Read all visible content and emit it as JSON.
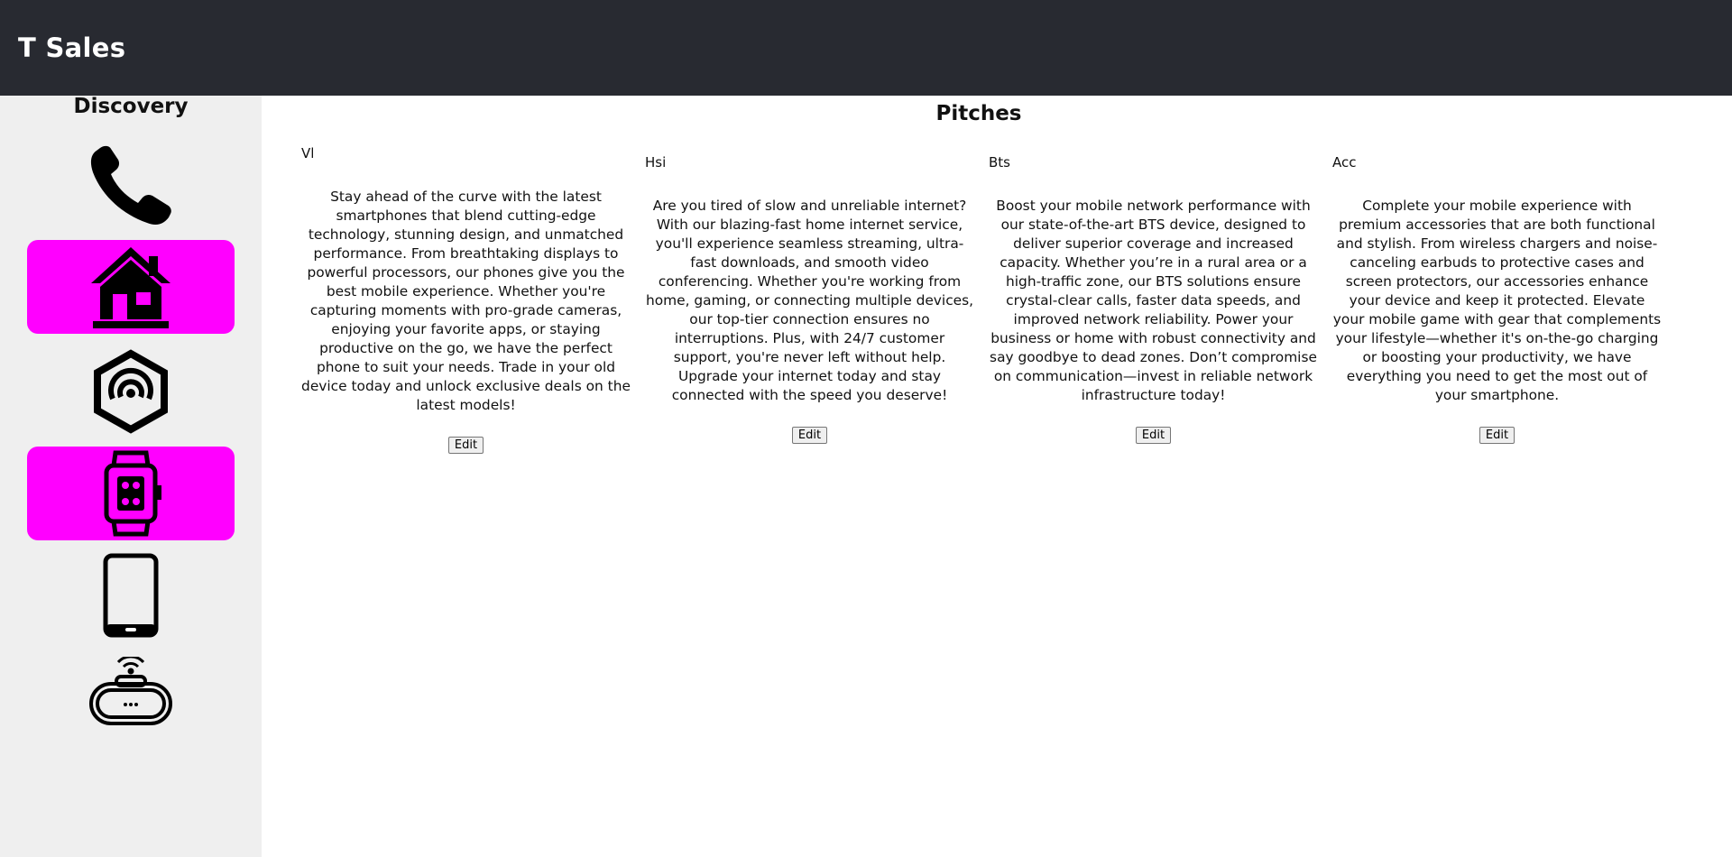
{
  "header": {
    "title": "T Sales"
  },
  "sidebar": {
    "title": "Discovery",
    "items": [
      {
        "icon": "phone-icon",
        "active": false
      },
      {
        "icon": "home-icon",
        "active": true
      },
      {
        "icon": "network-hexagon-icon",
        "active": false
      },
      {
        "icon": "smartwatch-icon",
        "active": true
      },
      {
        "icon": "tablet-icon",
        "active": false
      },
      {
        "icon": "router-icon",
        "active": false
      }
    ],
    "active_color": "#ff00ff"
  },
  "main": {
    "title": "Pitches",
    "cards": [
      {
        "name": "Vl",
        "text": "Stay ahead of the curve with the latest smartphones that blend cutting-edge technology, stunning design, and unmatched performance. From breathtaking displays to powerful processors, our phones give you the best mobile experience. Whether you're capturing moments with pro-grade cameras, enjoying your favorite apps, or staying productive on the go, we have the perfect phone to suit your needs. Trade in your old device today and unlock exclusive deals on the latest models!",
        "edit_label": "Edit"
      },
      {
        "name": "Hsi",
        "text": "Are you tired of slow and unreliable internet? With our blazing-fast home internet service, you'll experience seamless streaming, ultra-fast downloads, and smooth video conferencing. Whether you're working from home, gaming, or connecting multiple devices, our top-tier connection ensures no interruptions. Plus, with 24/7 customer support, you're never left without help. Upgrade your internet today and stay connected with the speed you deserve!",
        "edit_label": "Edit"
      },
      {
        "name": "Bts",
        "text": "Boost your mobile network performance with our state-of-the-art BTS device, designed to deliver superior coverage and increased capacity. Whether you’re in a rural area or a high-traffic zone, our BTS solutions ensure crystal-clear calls, faster data speeds, and improved network reliability. Power your business or home with robust connectivity and say goodbye to dead zones. Don’t compromise on communication—invest in reliable network infrastructure today!",
        "edit_label": "Edit"
      },
      {
        "name": "Acc",
        "text": "Complete your mobile experience with premium accessories that are both functional and stylish. From wireless chargers and noise-canceling earbuds to protective cases and screen protectors, our accessories enhance your device and keep it protected. Elevate your mobile game with gear that complements your lifestyle—whether it's on-the-go charging or boosting your productivity, we have everything you need to get the most out of your smartphone.",
        "edit_label": "Edit"
      }
    ]
  }
}
